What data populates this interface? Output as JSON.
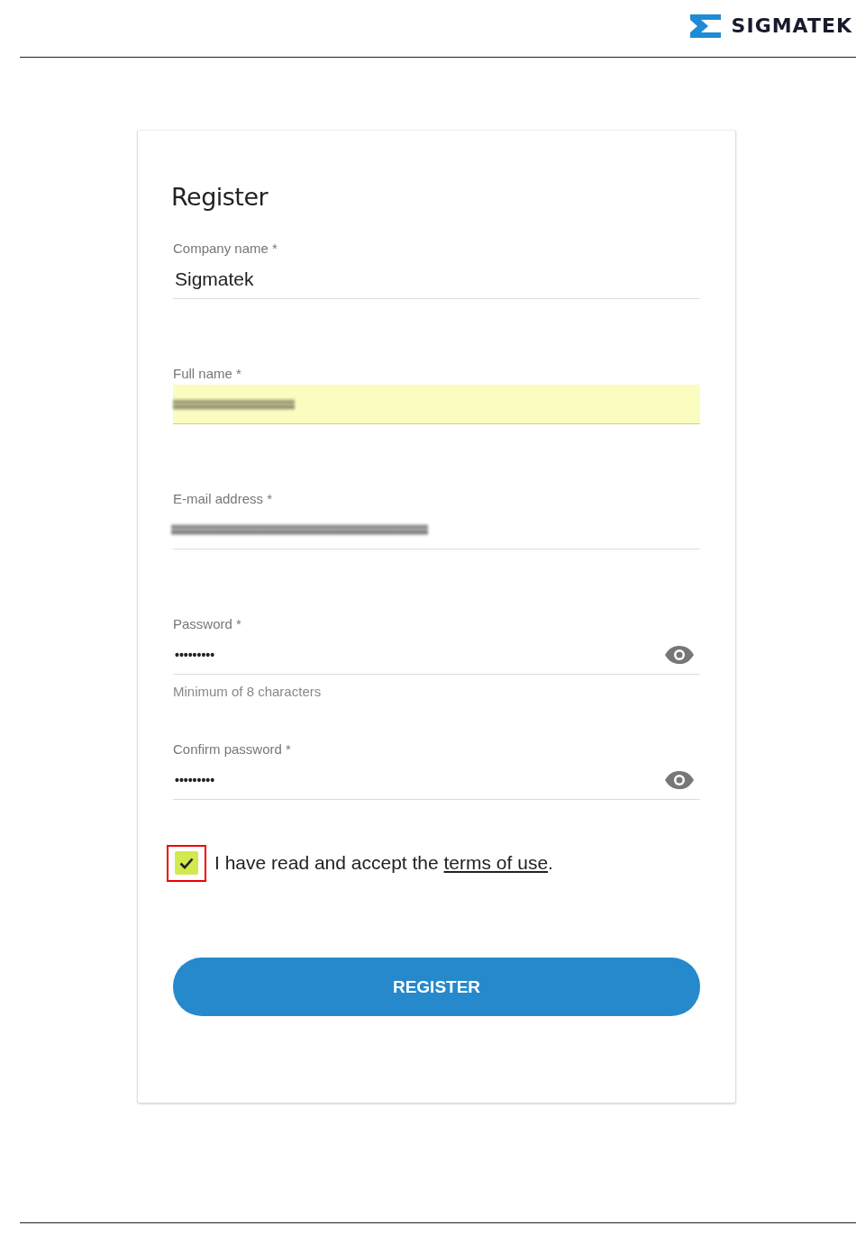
{
  "header": {
    "brand": "SIGMATEK"
  },
  "form": {
    "title": "Register",
    "fields": [
      {
        "label": "Company name *",
        "kind": "text",
        "value": "Sigmatek",
        "autofilled": false
      },
      {
        "label": "Full name *",
        "kind": "redacted",
        "autofilled": true
      },
      {
        "label": "E-mail address *",
        "kind": "redacted",
        "autofilled": false
      },
      {
        "label": "Password *",
        "kind": "password",
        "value": "•••••••••",
        "autofilled": false,
        "hint": "Minimum of 8 characters"
      },
      {
        "label": "Confirm password *",
        "kind": "password",
        "value": "•••••••••",
        "autofilled": false
      }
    ],
    "terms": {
      "checked": true,
      "highlighted": true,
      "text_before": "I have read and accept the ",
      "link": "terms of use",
      "text_after": "."
    },
    "submit": "REGISTER"
  }
}
